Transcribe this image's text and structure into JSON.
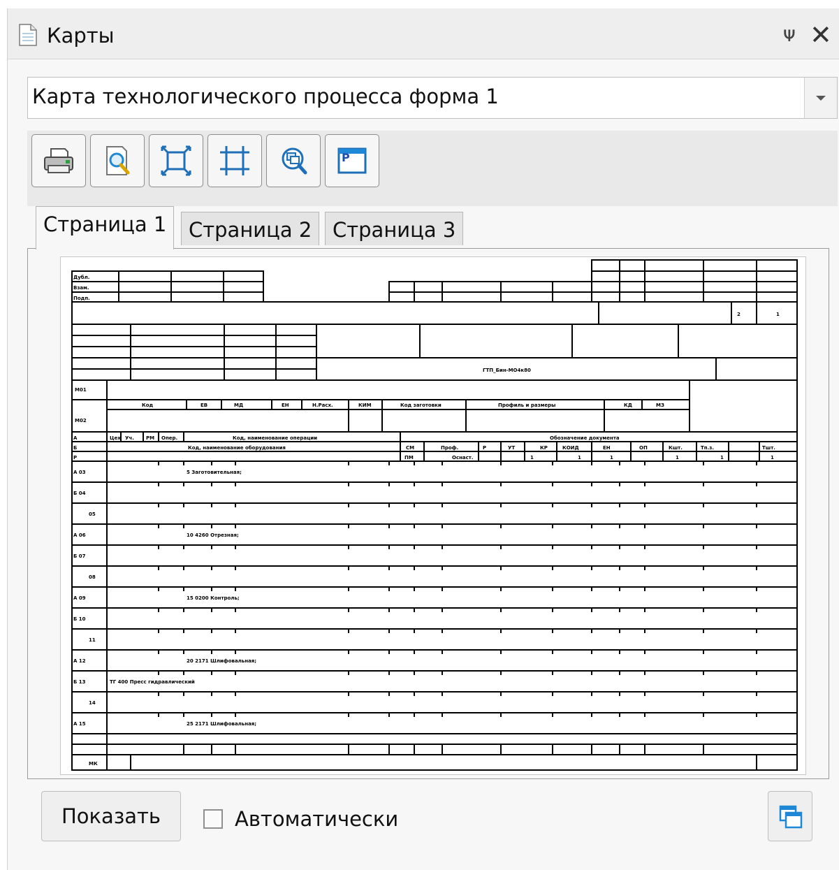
{
  "panel": {
    "title": "Карты",
    "icons": [
      "document-icon",
      "pin-icon",
      "close-icon"
    ],
    "pin_glyph": "ᵖ",
    "close_glyph": "✕"
  },
  "map_selector": {
    "selected": "Карта технологического процесса форма 1"
  },
  "toolbar": {
    "buttons": [
      "print-icon",
      "preview-zoom-icon",
      "fit-page-icon",
      "fit-width-icon",
      "zoom-window-icon",
      "properties-icon"
    ]
  },
  "tabs": [
    {
      "label": "Страница 1",
      "active": true
    },
    {
      "label": "Страница 2",
      "active": false
    },
    {
      "label": "Страница 3",
      "active": false
    }
  ],
  "document": {
    "header_labels": [
      "Дубл.",
      "Взам.",
      "Подп."
    ],
    "doc_code": "ГТП_Бин-МО4к80",
    "row_labels": [
      "М01",
      "М02",
      "МК"
    ],
    "mat_headers": [
      "Код",
      "ЕВ",
      "МД",
      "ЕН",
      "Н.Расх.",
      "КИМ",
      "Код заготовки",
      "Профиль и размеры",
      "КД",
      "МЗ"
    ],
    "oper_headers_a": [
      "Цех",
      "Уч.",
      "РМ",
      "Опер.",
      "Код, наименование операции",
      "Обозначение документа"
    ],
    "oper_headers_b": [
      "Код, наименование оборудования",
      "СМ",
      "Проф.",
      "Р",
      "УТ",
      "КР",
      "КОИД",
      "ЕН",
      "ОП",
      "Кшт.",
      "Тп.з.",
      "Тшт."
    ],
    "oper_values": [
      "ПМ",
      "Оснаст.",
      "1",
      "1",
      "1",
      "1",
      "1",
      "1"
    ],
    "rows": [
      {
        "num": "А 03",
        "text": "5 Заготовительная;"
      },
      {
        "num": "Б 04",
        "text": ""
      },
      {
        "num": "05",
        "text": ""
      },
      {
        "num": "А 06",
        "text": "10 4260 Отрезная;"
      },
      {
        "num": "Б 07",
        "text": ""
      },
      {
        "num": "08",
        "text": ""
      },
      {
        "num": "А 09",
        "text": "15 0200 Контроль;"
      },
      {
        "num": "Б 10",
        "text": ""
      },
      {
        "num": "11",
        "text": ""
      },
      {
        "num": "А 12",
        "text": "20 2171 Шлифовальная;"
      },
      {
        "num": "Б 13",
        "text": "ТГ 400 Пресс гидравлический"
      },
      {
        "num": "14",
        "text": ""
      },
      {
        "num": "А 15",
        "text": "25 2171 Шлифовальная;"
      }
    ],
    "page_num": "2",
    "page_total": "1"
  },
  "footer": {
    "show_label": "Показать",
    "auto_label": "Автоматически",
    "auto_checked": false,
    "icons": [
      "windows-icon"
    ]
  },
  "colors": {
    "accent": "#1e88d6",
    "print": "#2e9e3e"
  }
}
